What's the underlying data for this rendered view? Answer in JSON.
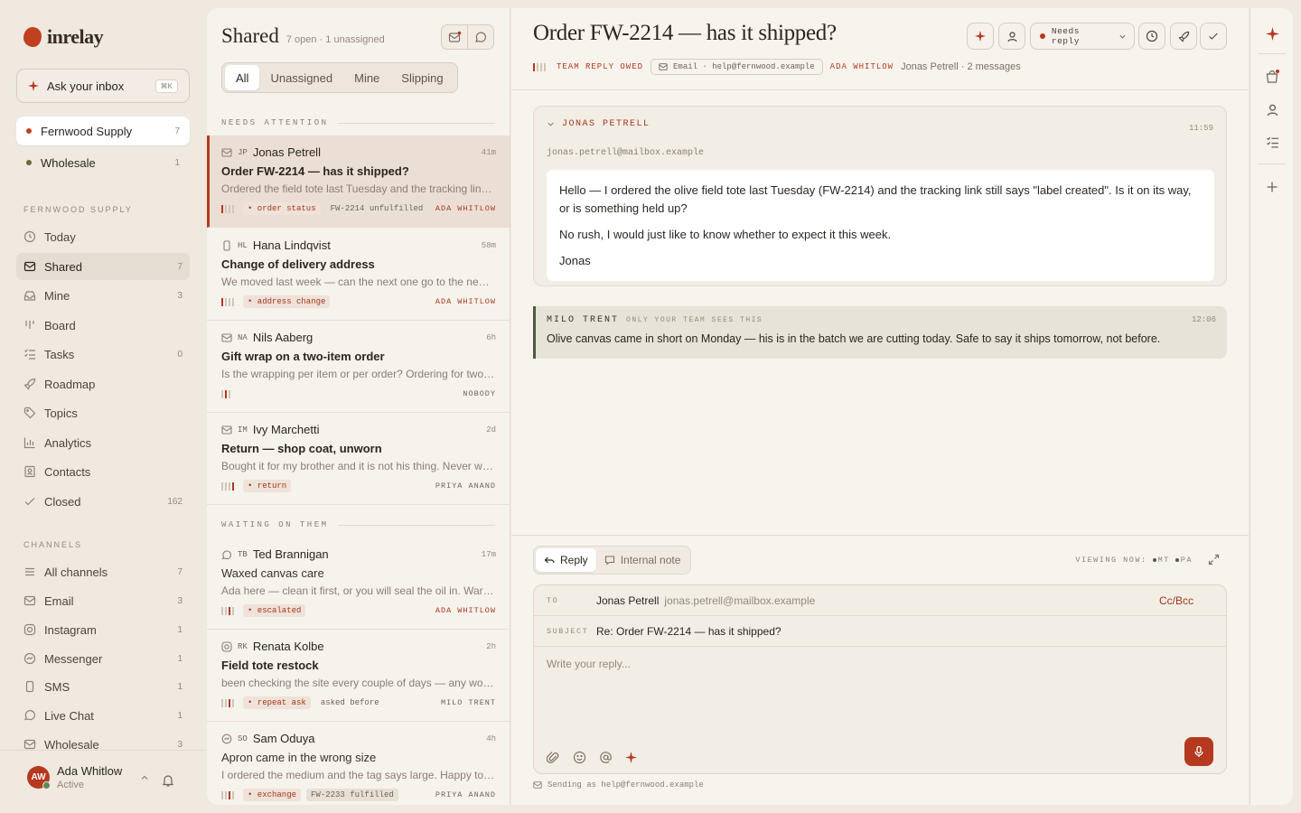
{
  "app": {
    "name": "inrelay",
    "ask": "Ask your inbox",
    "ask_kbd": "⌘K"
  },
  "workspaces": [
    {
      "label": "Fernwood Supply",
      "count": "7",
      "color": "#c0411f"
    },
    {
      "label": "Wholesale",
      "count": "1",
      "color": "#6d6a3a"
    }
  ],
  "sections": {
    "fernwood": "FERNWOOD SUPPLY",
    "channels": "CHANNELS"
  },
  "nav": [
    {
      "label": "Today",
      "count": "",
      "icon": "calendar-icon"
    },
    {
      "label": "Shared",
      "count": "7",
      "icon": "inbox-icon"
    },
    {
      "label": "Mine",
      "count": "3",
      "icon": "user-inbox-icon"
    },
    {
      "label": "Board",
      "count": "",
      "icon": "board-icon"
    },
    {
      "label": "Tasks",
      "count": "0",
      "icon": "tasks-icon"
    },
    {
      "label": "Roadmap",
      "count": "",
      "icon": "rocket-icon"
    },
    {
      "label": "Topics",
      "count": "",
      "icon": "tag-icon"
    },
    {
      "label": "Analytics",
      "count": "",
      "icon": "chart-icon"
    },
    {
      "label": "Contacts",
      "count": "",
      "icon": "contacts-icon"
    },
    {
      "label": "Closed",
      "count": "162",
      "icon": "check-icon"
    }
  ],
  "channels": [
    {
      "label": "All channels",
      "count": "7",
      "icon": "list-icon"
    },
    {
      "label": "Email",
      "count": "3",
      "icon": "mail-icon"
    },
    {
      "label": "Instagram",
      "count": "1",
      "icon": "instagram-icon"
    },
    {
      "label": "Messenger",
      "count": "1",
      "icon": "messenger-icon"
    },
    {
      "label": "SMS",
      "count": "1",
      "icon": "phone-icon"
    },
    {
      "label": "Live Chat",
      "count": "1",
      "icon": "chat-icon"
    },
    {
      "label": "Wholesale",
      "count": "3",
      "icon": "mail-icon"
    }
  ],
  "user": {
    "initials": "AW",
    "name": "Ada Whitlow",
    "status": "Active"
  },
  "list": {
    "title": "Shared",
    "subtitle": "7 open · 1 unassigned",
    "tabs": [
      "All",
      "Unassigned",
      "Mine",
      "Slipping"
    ],
    "group_attention": "NEEDS ATTENTION",
    "group_waiting": "WAITING ON THEM"
  },
  "conversations": [
    {
      "initials": "JP",
      "name": "Jonas Petrell",
      "time": "41m",
      "subject": "Order FW-2214 — has it shipped?",
      "preview": "Ordered the field tote last Tuesday and the tracking link still says \"label created\". Is it on its way",
      "tags": [
        "• order status",
        "FW-2214 unfulfilled"
      ],
      "owner": "ADA WHITLOW",
      "bars": 1
    },
    {
      "initials": "HL",
      "name": "Hana Lindqvist",
      "time": "58m",
      "subject": "Change of delivery address",
      "preview": "We moved last week — can the next one go to the new place on Birch Lane?",
      "tags": [
        "• address change"
      ],
      "owner": "ADA WHITLOW",
      "bars": 1
    },
    {
      "initials": "NA",
      "name": "Nils Aaberg",
      "time": "6h",
      "subject": "Gift wrap on a two-item order",
      "preview": "Is the wrapping per item or per order? Ordering for two people",
      "tags": [],
      "owner": "NOBODY",
      "bars": 1
    },
    {
      "initials": "IM",
      "name": "Ivy Marchetti",
      "time": "2d",
      "subject": "Return — shop coat, unworn",
      "preview": "Bought it for my brother and it is not his thing. Never worn, tags on",
      "tags": [
        "• return"
      ],
      "owner": "PRIYA ANAND",
      "bars": 1
    },
    {
      "initials": "TB",
      "name": "Ted Brannigan",
      "time": "17m",
      "subject": "Waxed canvas care",
      "preview": "Ada here — clean it first, or you will seal the oil in. Warm water and a soft brush",
      "tags": [
        "• escalated"
      ],
      "owner": "ADA WHITLOW",
      "bars": 1
    },
    {
      "initials": "RK",
      "name": "Renata Kolbe",
      "time": "2h",
      "subject": "Field tote restock",
      "preview": "been checking the site every couple of days — any word on the olive one?",
      "tags": [
        "• repeat ask",
        "asked before"
      ],
      "owner": "MILO TRENT",
      "bars": 1
    },
    {
      "initials": "SO",
      "name": "Sam Oduya",
      "time": "4h",
      "subject": "Apron came in the wrong size",
      "preview": "I ordered the medium and the tag says large. Happy to swap if you have one",
      "tags": [
        "• exchange",
        "FW-2233 fulfilled"
      ],
      "owner": "PRIYA ANAND",
      "bars": 1
    }
  ],
  "thread": {
    "title": "Order FW-2214 — has it shipped?",
    "status": "TEAM REPLY OWED",
    "channel_chip": "Email · help@fernwood.example",
    "assignee": "ADA WHITLOW",
    "meta": "Jonas Petrell · 2 messages",
    "needs_reply": "Needs reply",
    "message": {
      "sender": "JONAS PETRELL",
      "email": "jonas.petrell@mailbox.example",
      "time": "11:59",
      "p1": "Hello — I ordered the olive field tote last Tuesday (FW-2214) and the tracking link still says \"label created\". Is it on its way, or is something held up?",
      "p2": "No rush, I would just like to know whether to expect it this week.",
      "p3": "Jonas"
    },
    "note": {
      "sender": "MILO TRENT",
      "visibility": "ONLY YOUR TEAM SEES THIS",
      "time": "12:06",
      "text": "Olive canvas came in short on Monday — his is in the batch we are cutting today. Safe to say it ships tomorrow, not before."
    }
  },
  "composer": {
    "reply_tab": "Reply",
    "note_tab": "Internal note",
    "viewing": "VIEWING NOW:",
    "viewers": [
      "MT",
      "PA"
    ],
    "to_label": "TO",
    "to_name": "Jonas Petrell",
    "to_email": "jonas.petrell@mailbox.example",
    "ccbcc": "Cc/Bcc",
    "subject_label": "SUBJECT",
    "subject": "Re: Order FW-2214 — has it shipped?",
    "placeholder": "Write your reply...",
    "sending_as": "Sending as help@fernwood.example"
  }
}
